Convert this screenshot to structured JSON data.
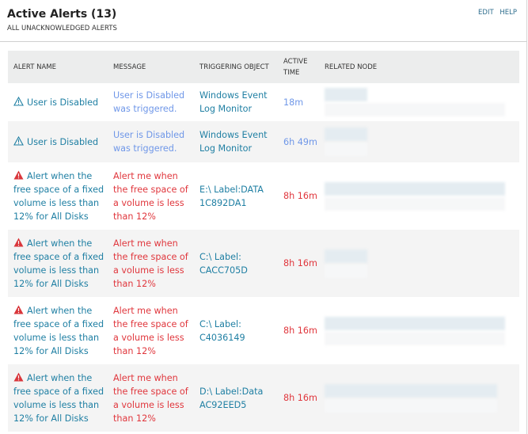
{
  "header": {
    "title": "Active Alerts (13)",
    "subtitle": "ALL UNACKNOWLEDGED ALERTS",
    "edit": "EDIT",
    "help": "HELP"
  },
  "columns": [
    "ALERT NAME",
    "MESSAGE",
    "TRIGGERING OBJECT",
    "ACTIVE TIME",
    "RELATED NODE"
  ],
  "rows": [
    {
      "severity": "warning",
      "name": "User is Disabled",
      "message": "User is Disabled was triggered.",
      "object": "Windows Event Log Monitor",
      "time": "18m"
    },
    {
      "severity": "warning",
      "name": "User is Disabled",
      "message": "User is Disabled was triggered.",
      "object": "Windows Event Log Monitor",
      "time": "6h 49m"
    },
    {
      "severity": "critical",
      "name": "Alert when the free space of a fixed volume is less than 12% for All Disks",
      "message": "Alert me when the free space of a volume is less than 12%",
      "object": "E:\\ Label:DATA 1C892DA1",
      "time": "8h 16m"
    },
    {
      "severity": "critical",
      "name": "Alert when the free space of a fixed volume is less than 12% for All Disks",
      "message": "Alert me when the free space of a volume is less than 12%",
      "object": "C:\\ Label: CACC705D",
      "time": "8h 16m"
    },
    {
      "severity": "critical",
      "name": "Alert when the free space of a fixed volume is less than 12% for All Disks",
      "message": "Alert me when the free space of a volume is less than 12%",
      "object": "C:\\ Label: C4036149",
      "time": "8h 16m"
    },
    {
      "severity": "critical",
      "name": "Alert when the free space of a fixed volume is less than 12% for All Disks",
      "message": "Alert me when the free space of a volume is less than 12%",
      "object": "D:\\ Label:Data AC92EED5",
      "time": "8h 16m"
    }
  ]
}
